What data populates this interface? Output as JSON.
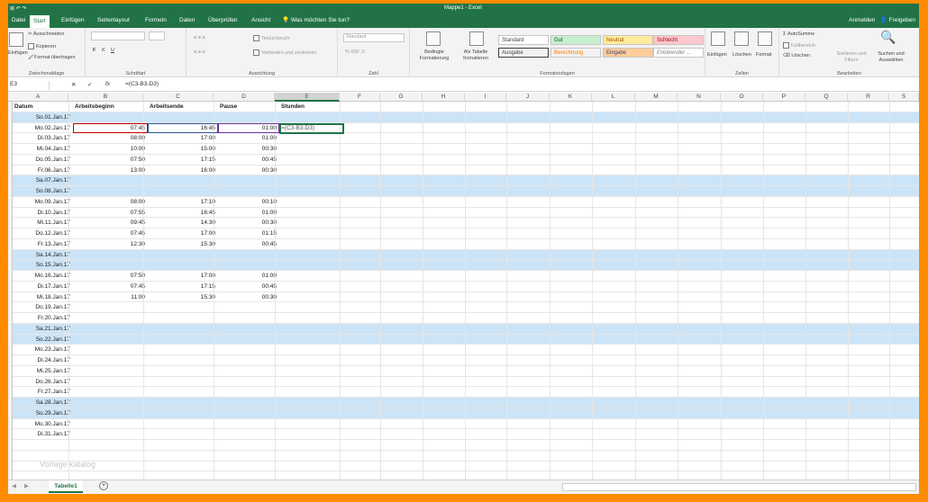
{
  "titlebar": {
    "quick_access": "⊞ ↶ ↷",
    "title": "Mappe1 - Excel"
  },
  "tabs": [
    "Datei",
    "Start",
    "Einfügen",
    "Seitenlayout",
    "Formeln",
    "Daten",
    "Überprüfen",
    "Ansicht"
  ],
  "tellme": "Was möchten Sie tun?",
  "account": {
    "signin": "Anmelden",
    "share": "Freigeben"
  },
  "ribbon": {
    "clipboard": {
      "paste": "Einfügen",
      "cut": "Ausschneiden",
      "copy": "Kopieren",
      "format_painter": "Format übertragen",
      "label": "Zwischenablage"
    },
    "font": {
      "label": "Schriftart",
      "bold": "F",
      "italic": "K",
      "underline": "U"
    },
    "alignment": {
      "wrap": "Textumbruch",
      "merge": "Verbinden und zentrieren",
      "label": "Ausrichtung"
    },
    "number": {
      "format": "Standard",
      "label": "Zahl"
    },
    "styles": {
      "cond": "Bedingte Formatierung",
      "table": "Als Tabelle formatieren",
      "cells": [
        "Standard",
        "Gut",
        "Neutral",
        "Schlecht",
        "Ausgabe",
        "Berechnung",
        "Eingabe",
        "Erklärender ..."
      ],
      "label": "Formatvorlagen"
    },
    "cells": {
      "insert": "Einfügen",
      "delete": "Löschen",
      "format": "Format",
      "label": "Zellen"
    },
    "editing": {
      "autosum": "AutoSumme",
      "fill": "Füllbereich",
      "clear": "Löschen",
      "sort": "Sortieren und Filtern",
      "find": "Suchen und Auswählen",
      "label": "Bearbeiten"
    }
  },
  "formula_bar": {
    "namebox": "E3",
    "cancel": "✕",
    "enter": "✓",
    "fx": "fx",
    "formula": "=(C3-B3-D3)"
  },
  "columns": [
    "A",
    "B",
    "C",
    "D",
    "E",
    "F",
    "G",
    "H",
    "I",
    "J",
    "K",
    "L",
    "M",
    "N",
    "O",
    "P",
    "Q",
    "R",
    "S"
  ],
  "headers": {
    "a": "Datum",
    "b": "Arbeitsbeginn",
    "c": "Arbeitsende",
    "d": "Pause",
    "e": "Stunden"
  },
  "rows": [
    {
      "date": "So.01.Jan.17",
      "start": "",
      "end": "",
      "pause": "",
      "hl": true
    },
    {
      "date": "Mo.02.Jan.17",
      "start": "07:45",
      "end": "16:45",
      "pause": "01:00",
      "hl": false
    },
    {
      "date": "Di.03.Jan.17",
      "start": "08:00",
      "end": "17:00",
      "pause": "01:00",
      "hl": false
    },
    {
      "date": "Mi.04.Jan.17",
      "start": "10:00",
      "end": "15:00",
      "pause": "00:30",
      "hl": false
    },
    {
      "date": "Do.05.Jan.17",
      "start": "07:50",
      "end": "17:15",
      "pause": "00:45",
      "hl": false
    },
    {
      "date": "Fr.06.Jan.17",
      "start": "13:00",
      "end": "16:00",
      "pause": "00:30",
      "hl": false
    },
    {
      "date": "Sa.07.Jan.17",
      "start": "",
      "end": "",
      "pause": "",
      "hl": true
    },
    {
      "date": "So.08.Jan.17",
      "start": "",
      "end": "",
      "pause": "",
      "hl": true
    },
    {
      "date": "Mo.09.Jan.17",
      "start": "08:00",
      "end": "17:10",
      "pause": "00:10",
      "hl": false
    },
    {
      "date": "Di.10.Jan.17",
      "start": "07:55",
      "end": "16:45",
      "pause": "01:00",
      "hl": false
    },
    {
      "date": "Mi.11.Jan.17",
      "start": "09:45",
      "end": "14:30",
      "pause": "00:30",
      "hl": false
    },
    {
      "date": "Do.12.Jan.17",
      "start": "07:45",
      "end": "17:00",
      "pause": "01:15",
      "hl": false
    },
    {
      "date": "Fr.13.Jan.17",
      "start": "12:30",
      "end": "15:30",
      "pause": "00:45",
      "hl": false
    },
    {
      "date": "Sa.14.Jan.17",
      "start": "",
      "end": "",
      "pause": "",
      "hl": true
    },
    {
      "date": "So.15.Jan.17",
      "start": "",
      "end": "",
      "pause": "",
      "hl": true
    },
    {
      "date": "Mo.16.Jan.17",
      "start": "07:50",
      "end": "17:00",
      "pause": "01:00",
      "hl": false
    },
    {
      "date": "Di.17.Jan.17",
      "start": "07:45",
      "end": "17:15",
      "pause": "00:45",
      "hl": false
    },
    {
      "date": "Mi.18.Jan.17",
      "start": "11:00",
      "end": "15:30",
      "pause": "00:30",
      "hl": false
    },
    {
      "date": "Do.19.Jan.17",
      "start": "",
      "end": "",
      "pause": "",
      "hl": false
    },
    {
      "date": "Fr.20.Jan.17",
      "start": "",
      "end": "",
      "pause": "",
      "hl": false
    },
    {
      "date": "Sa.21.Jan.17",
      "start": "",
      "end": "",
      "pause": "",
      "hl": true
    },
    {
      "date": "So.22.Jan.17",
      "start": "",
      "end": "",
      "pause": "",
      "hl": true
    },
    {
      "date": "Mo.23.Jan.17",
      "start": "",
      "end": "",
      "pause": "",
      "hl": false
    },
    {
      "date": "Di.24.Jan.17",
      "start": "",
      "end": "",
      "pause": "",
      "hl": false
    },
    {
      "date": "Mi.25.Jan.17",
      "start": "",
      "end": "",
      "pause": "",
      "hl": false
    },
    {
      "date": "Do.26.Jan.17",
      "start": "",
      "end": "",
      "pause": "",
      "hl": false
    },
    {
      "date": "Fr.27.Jan.17",
      "start": "",
      "end": "",
      "pause": "",
      "hl": false
    },
    {
      "date": "Sa.28.Jan.17",
      "start": "",
      "end": "",
      "pause": "",
      "hl": true
    },
    {
      "date": "So.29.Jan.17",
      "start": "",
      "end": "",
      "pause": "",
      "hl": true
    },
    {
      "date": "Mo.30.Jan.17",
      "start": "",
      "end": "",
      "pause": "",
      "hl": false
    },
    {
      "date": "Di.31.Jan.17",
      "start": "",
      "end": "",
      "pause": "",
      "hl": false
    }
  ],
  "editing_formula": "=(C3-B3-D3)",
  "watermark": "Vorlage katalog",
  "sheet_tab": "Tabelle1",
  "add_sheet": "+",
  "colors": {
    "excel_green": "#217346",
    "weekend": "#cce4f7",
    "frame": "#ff8c00"
  }
}
